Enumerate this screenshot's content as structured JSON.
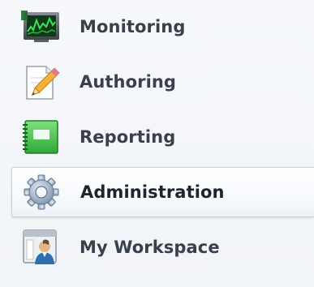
{
  "nav": {
    "items": [
      {
        "label": "Monitoring",
        "icon": "monitoring-screen-icon",
        "selected": false
      },
      {
        "label": "Authoring",
        "icon": "authoring-pencil-icon",
        "selected": false
      },
      {
        "label": "Reporting",
        "icon": "reporting-notebook-icon",
        "selected": false
      },
      {
        "label": "Administration",
        "icon": "administration-gear-icon",
        "selected": true
      },
      {
        "label": "My Workspace",
        "icon": "my-workspace-user-icon",
        "selected": false
      }
    ]
  },
  "colors": {
    "background": "#f4f6f9",
    "selected_border": "#c9d1db",
    "label_text": "#38404b",
    "monitor_green": "#2fb24a",
    "report_green": "#52c94e"
  }
}
